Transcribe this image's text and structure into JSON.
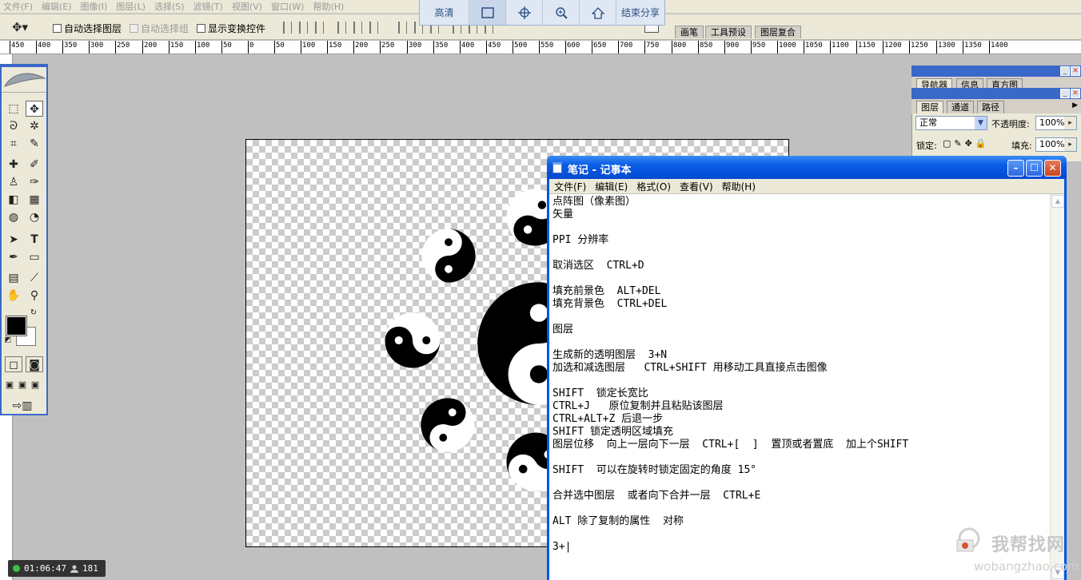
{
  "ps_menu": [
    "文件(F)",
    "编辑(E)",
    "图像(I)",
    "图层(L)",
    "选择(S)",
    "滤镜(T)",
    "视图(V)",
    "窗口(W)",
    "帮助(H)"
  ],
  "share_bar": {
    "quality": "高清",
    "end_label": "结束分享",
    "icons": [
      "select-rect-icon",
      "crosshair-icon",
      "zoom-in-icon",
      "home-icon"
    ]
  },
  "options": {
    "auto_select_layer": "自动选择图层",
    "auto_select_group": "自动选择组",
    "show_transform": "显示变换控件"
  },
  "palette_well": {
    "tabs": [
      "画笔",
      "工具预设",
      "图层复合"
    ]
  },
  "ruler": {
    "labels": [
      "450",
      "400",
      "350",
      "300",
      "250",
      "200",
      "150",
      "100",
      "50",
      "0",
      "50",
      "100",
      "150",
      "200",
      "250",
      "300",
      "350",
      "400",
      "450",
      "500",
      "550",
      "600",
      "650",
      "700",
      "750",
      "800",
      "850",
      "900",
      "950",
      "1000",
      "1050",
      "1100",
      "1150",
      "1200",
      "1250",
      "1300",
      "1350",
      "1400"
    ]
  },
  "navigator_panel": {
    "tabs": [
      "导航器",
      "信息",
      "直方图"
    ]
  },
  "layers_panel": {
    "tabs": [
      "图层",
      "通道",
      "路径"
    ],
    "blend_mode": "正常",
    "opacity_label": "不透明度:",
    "opacity_value": "100%",
    "lock_label": "锁定:",
    "fill_label": "填充:",
    "fill_value": "100%"
  },
  "notepad": {
    "title": "笔记 - 记事本",
    "menu": [
      "文件(F)",
      "编辑(E)",
      "格式(O)",
      "查看(V)",
      "帮助(H)"
    ],
    "lines": [
      "点阵图（像素图）",
      "矢量",
      "",
      "PPI 分辨率",
      "",
      "取消选区  CTRL+D",
      "",
      "填充前景色  ALT+DEL",
      "填充背景色  CTRL+DEL",
      "",
      "图层",
      "",
      "生成新的透明图层  3+N",
      "加选和减选图层   CTRL+SHIFT 用移动工具直接点击图像",
      "",
      "SHIFT  锁定长宽比",
      "CTRL+J   原位复制并且粘贴该图层",
      "CTRL+ALT+Z 后退一步",
      "SHIFT 锁定透明区域填充",
      "图层位移  向上一层向下一层  CTRL+[  ]  置顶或者置底  加上个SHIFT",
      "",
      "SHIFT  可以在旋转时锁定固定的角度 15°",
      "",
      "合并选中图层  或者向下合并一层  CTRL+E",
      "",
      "ALT 除了复制的属性  对称",
      "",
      "3+|"
    ]
  },
  "recorder": {
    "time": "01:06:47",
    "viewers": "181"
  },
  "watermark": {
    "text": "我帮找网",
    "url": "wobangzhao.com"
  },
  "colors": {
    "xp_blue": "#0055e5",
    "panel_blue": "#3a68c9",
    "watermark_red": "#d8533a"
  }
}
